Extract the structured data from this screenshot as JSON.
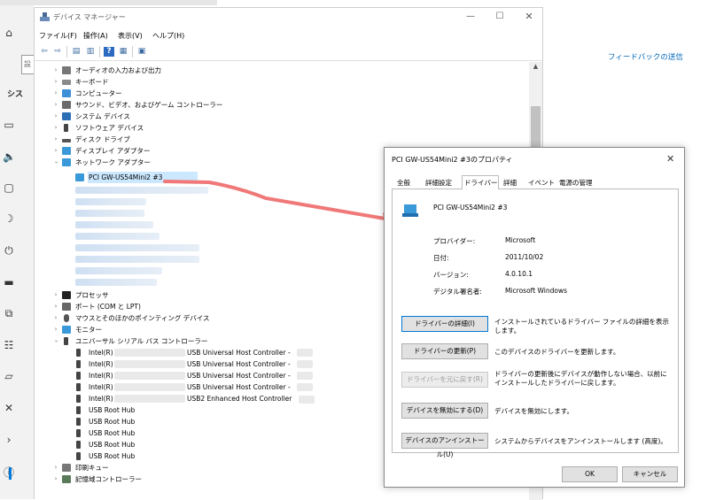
{
  "settings_bg": {
    "sidebar_label": "シス",
    "search_partial": "設",
    "feedback_link": "フィードバックの送信"
  },
  "device_manager": {
    "title": "デバイス マネージャー",
    "menu": [
      "ファイル(F)",
      "操作(A)",
      "表示(V)",
      "ヘルプ(H)"
    ],
    "tree": {
      "top_items": [
        "オーディオの入力および出力",
        "キーボード",
        "コンピューター",
        "サウンド、ビデオ、およびゲーム コントローラー",
        "システム デバイス",
        "ソフトウェア デバイス",
        "ディスク ドライブ",
        "ディスプレイ アダプター",
        "ネットワーク アダプター"
      ],
      "selected_adapter": "PCI GW-US54Mini2 #3",
      "mid_items": [
        "プロセッサ",
        "ポート (COM と LPT)",
        "マウスとそのほかのポインティング デバイス",
        "モニター",
        "ユニバーサル シリアル バス コントローラー"
      ],
      "usb_controllers": [
        {
          "prefix": "Intel(R)",
          "suffix": "USB Universal Host Controller -"
        },
        {
          "prefix": "Intel(R)",
          "suffix": "USB Universal Host Controller -"
        },
        {
          "prefix": "Intel(R)",
          "suffix": "USB Universal Host Controller -"
        },
        {
          "prefix": "Intel(R)",
          "suffix": "USB Universal Host Controller -"
        },
        {
          "prefix": "Intel(R)",
          "suffix": "USB2 Enhanced Host Controller"
        }
      ],
      "usb_hubs": [
        "USB Root Hub",
        "USB Root Hub",
        "USB Root Hub",
        "USB Root Hub",
        "USB Root Hub"
      ],
      "bottom_items": [
        "印刷キュー",
        "記憶域コントローラー"
      ]
    }
  },
  "properties": {
    "title": "PCI GW-US54Mini2 #3のプロパティ",
    "tabs": [
      "全般",
      "詳細設定",
      "ドライバー",
      "詳細",
      "イベント",
      "電源の管理"
    ],
    "active_tab": "ドライバー",
    "device_name": "PCI GW-US54Mini2 #3",
    "fields": [
      {
        "label": "プロバイダー:",
        "value": "Microsoft"
      },
      {
        "label": "日付:",
        "value": "2011/10/02"
      },
      {
        "label": "バージョン:",
        "value": "4.0.10.1"
      },
      {
        "label": "デジタル署名者:",
        "value": "Microsoft Windows"
      }
    ],
    "actions": [
      {
        "button": "ドライバーの詳細(I)",
        "desc": "インストールされているドライバー ファイルの詳細を表示します。"
      },
      {
        "button": "ドライバーの更新(P)",
        "desc": "このデバイスのドライバーを更新します。"
      },
      {
        "button": "ドライバーを元に戻す(R)",
        "desc": "ドライバーの更新後にデバイスが動作しない場合、以前にインストールしたドライバーに戻します。"
      },
      {
        "button": "デバイスを無効にする(D)",
        "desc": "デバイスを無効にします。"
      },
      {
        "button": "デバイスのアンインストール(U)",
        "desc": "システムからデバイスをアンインストールします (高度)。"
      }
    ],
    "ok_label": "OK",
    "cancel_label": "キャンセル"
  },
  "colors": {
    "arrow": "#f07878",
    "selection": "#cce8ff",
    "link": "#0067b8"
  }
}
